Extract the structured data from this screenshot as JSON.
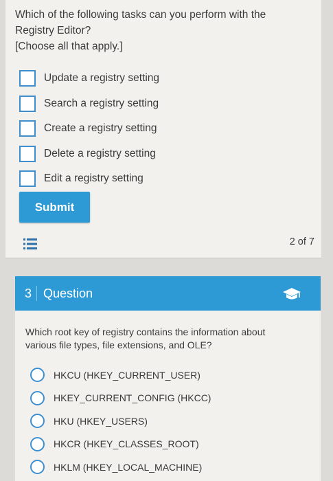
{
  "question2": {
    "text_lines": [
      "Which of the following tasks can you perform with the",
      "Registry Editor?",
      "[Choose all that apply.]"
    ],
    "options": [
      "Update a registry setting",
      "Search a registry setting",
      "Create a registry setting",
      "Delete a registry setting",
      "Edit a registry setting"
    ],
    "submit_label": "Submit",
    "page_counter": "2 of 7"
  },
  "question3": {
    "number": "3",
    "header_title": "Question",
    "text_lines": [
      "Which root key of registry contains the information about",
      "various file types, file extensions, and OLE?"
    ],
    "options": [
      "HKCU (HKEY_CURRENT_USER)",
      "HKEY_CURRENT_CONFIG (HKCC)",
      "HKU (HKEY_USERS)",
      "HKCR (HKEY_CLASSES_ROOT)",
      "HKLM (HKEY_LOCAL_MACHINE)"
    ]
  },
  "icons": {
    "list": "list-icon",
    "header": "graduation-cap-icon"
  },
  "colors": {
    "accent": "#2d9ad6",
    "checkbox_border": "#3f8fcf",
    "card_bg": "#f2f1ee",
    "page_bg": "#dcdbd8"
  }
}
